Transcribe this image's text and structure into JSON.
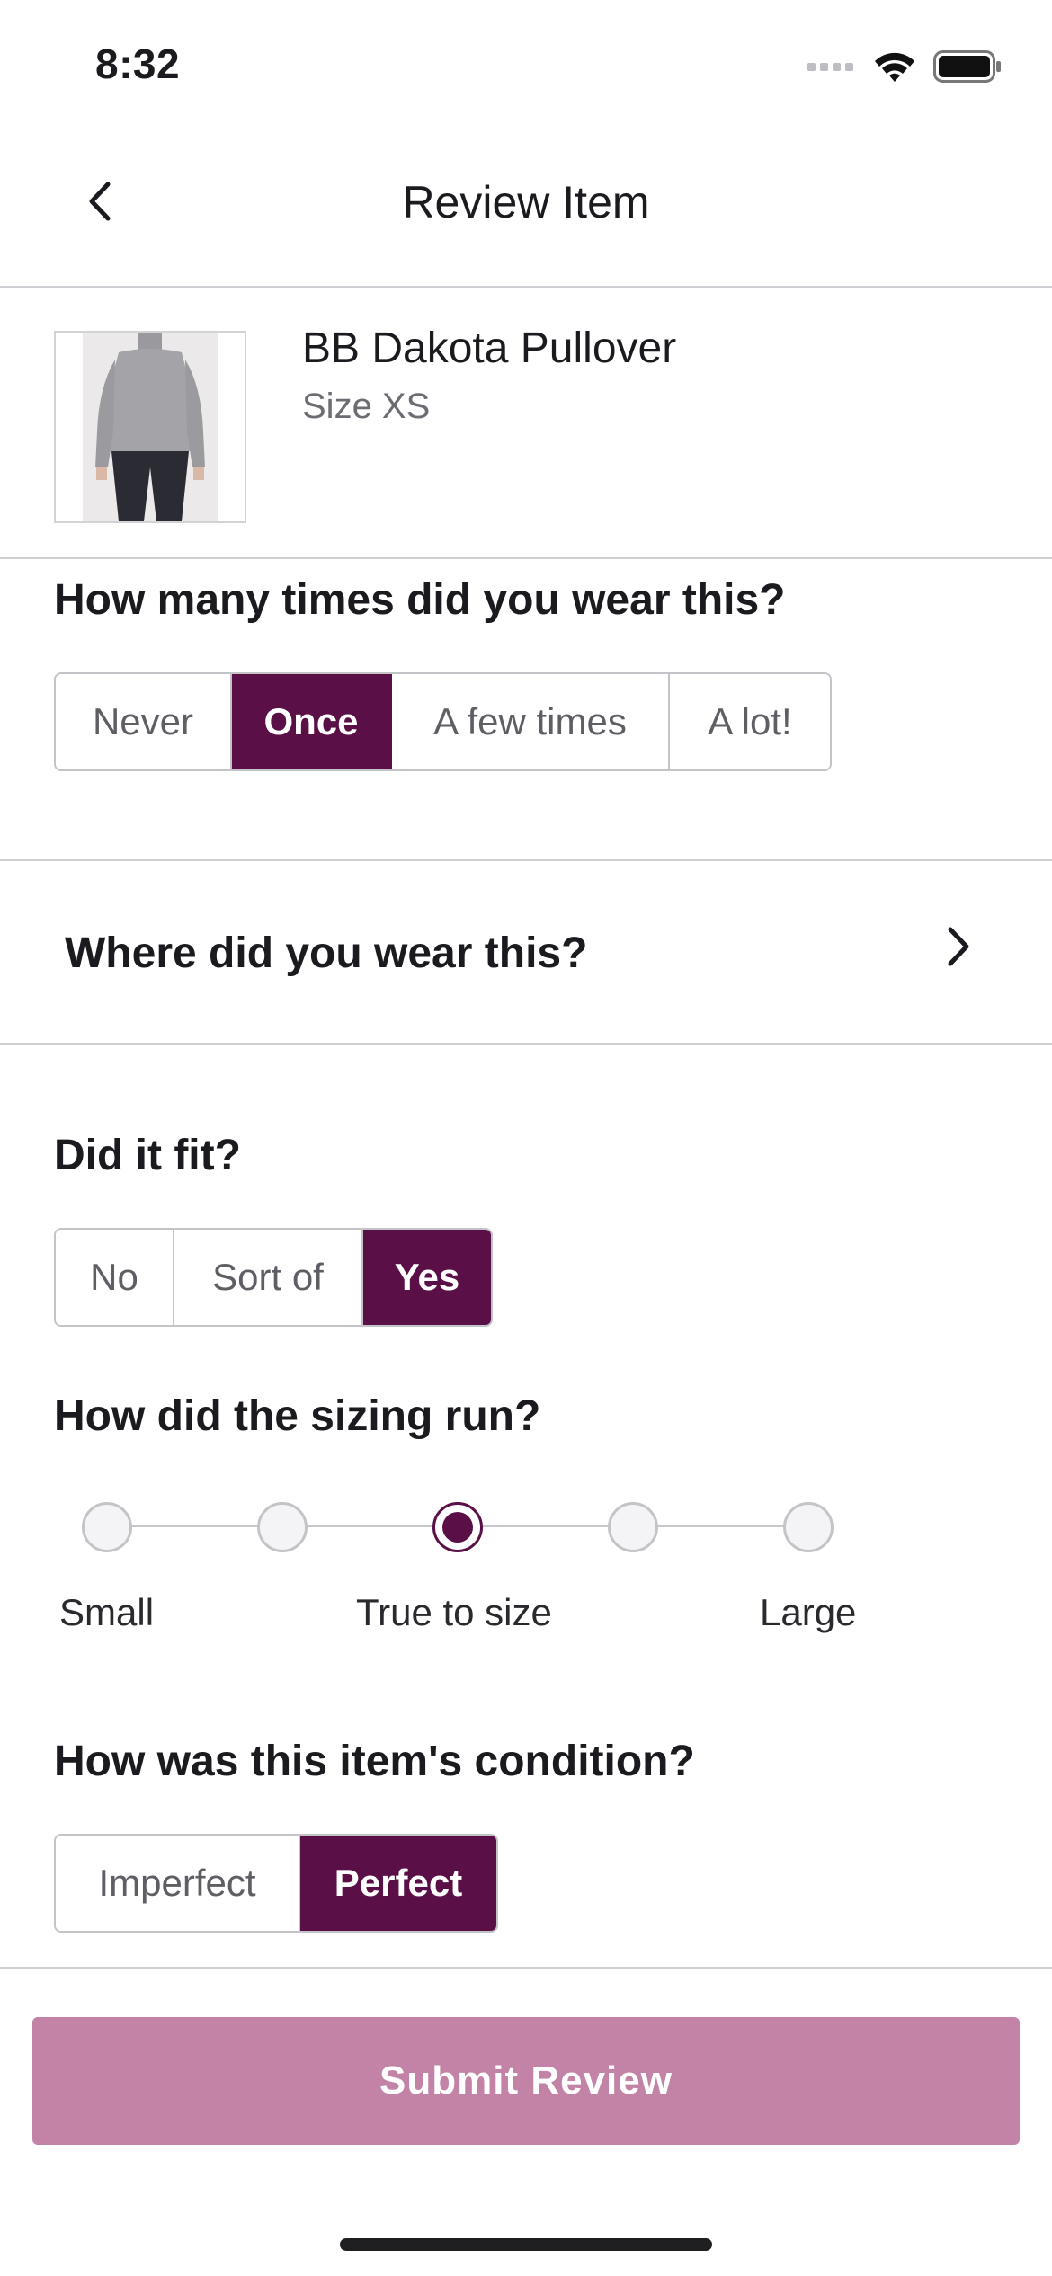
{
  "status_bar": {
    "time": "8:32"
  },
  "nav": {
    "title": "Review Item"
  },
  "product": {
    "name": "BB Dakota Pullover",
    "size": "Size XS"
  },
  "wear_count": {
    "question": "How many times did you wear this?",
    "options": [
      "Never",
      "Once",
      "A few times",
      "A lot!"
    ],
    "selected": "Once"
  },
  "where_worn": {
    "label": "Where did you wear this?"
  },
  "fit": {
    "question": "Did it fit?",
    "options": [
      "No",
      "Sort of",
      "Yes"
    ],
    "selected": "Yes"
  },
  "sizing": {
    "question": "How did the sizing run?",
    "steps": 5,
    "selected_step": 3,
    "labels": {
      "small": "Small",
      "true": "True to size",
      "large": "Large"
    }
  },
  "condition": {
    "question": "How was this item's condition?",
    "options": [
      "Imperfect",
      "Perfect"
    ],
    "selected": "Perfect"
  },
  "submit": {
    "label": "Submit Review"
  },
  "colors": {
    "accent": "#5b0f47",
    "submit_bg": "#c283a7"
  }
}
